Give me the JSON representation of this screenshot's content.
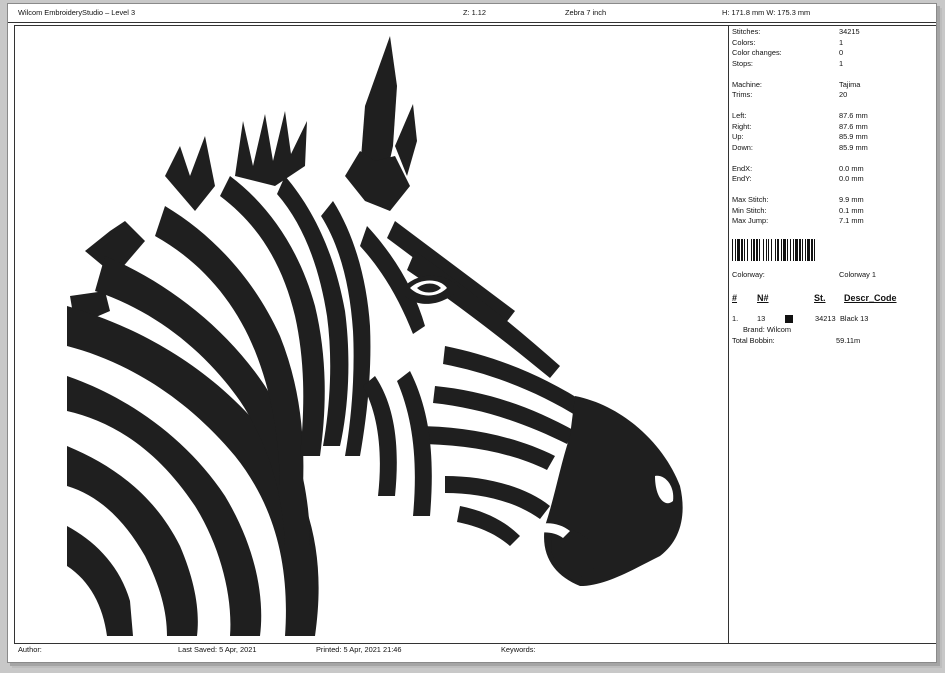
{
  "header": {
    "app_title": "Wilcom EmbroideryStudio – Level 3",
    "zoom": "Z: 1.12",
    "design_name": "Zebra 7 inch",
    "size": "H: 171.8 mm   W: 175.3 mm"
  },
  "stats": [
    {
      "label": "Stitches:",
      "value": "34215"
    },
    {
      "label": "Colors:",
      "value": "1"
    },
    {
      "label": "Color changes:",
      "value": "0"
    },
    {
      "label": "Stops:",
      "value": "1"
    },
    {
      "label": "Machine:",
      "value": "Tajima"
    },
    {
      "label": "Trims:",
      "value": "20"
    },
    {
      "label": "Left:",
      "value": "87.6 mm"
    },
    {
      "label": "Right:",
      "value": "87.6 mm"
    },
    {
      "label": "Up:",
      "value": "85.9 mm"
    },
    {
      "label": "Down:",
      "value": "85.9 mm"
    },
    {
      "label": "EndX:",
      "value": "0.0 mm"
    },
    {
      "label": "EndY:",
      "value": "0.0 mm"
    },
    {
      "label": "Max Stitch:",
      "value": "9.9 mm"
    },
    {
      "label": "Min Stitch:",
      "value": "0.1 mm"
    },
    {
      "label": "Max Jump:",
      "value": "7.1 mm"
    }
  ],
  "colorway": {
    "label": "Colorway:",
    "value": "Colorway 1"
  },
  "color_table": {
    "headers": {
      "num": "#",
      "n": "N#",
      "st": "St.",
      "descr": "Descr_Code"
    },
    "rows": [
      {
        "num": "1.",
        "n": "13",
        "swatch_color": "#111111",
        "st": "34213",
        "descr": "Black 13",
        "brand": "Brand: Wilcom"
      }
    ],
    "total_bobbin_label": "Total Bobbin:",
    "total_bobbin_value": "59.11m"
  },
  "footer": {
    "author": "Author:",
    "last_saved": "Last Saved:  5 Apr, 2021",
    "printed": "Printed:  5 Apr, 2021 21:46",
    "keywords": "Keywords:"
  },
  "colors": {
    "thread": "#1f1f1f",
    "page": "#ffffff",
    "frame": "#c8c8c8"
  }
}
